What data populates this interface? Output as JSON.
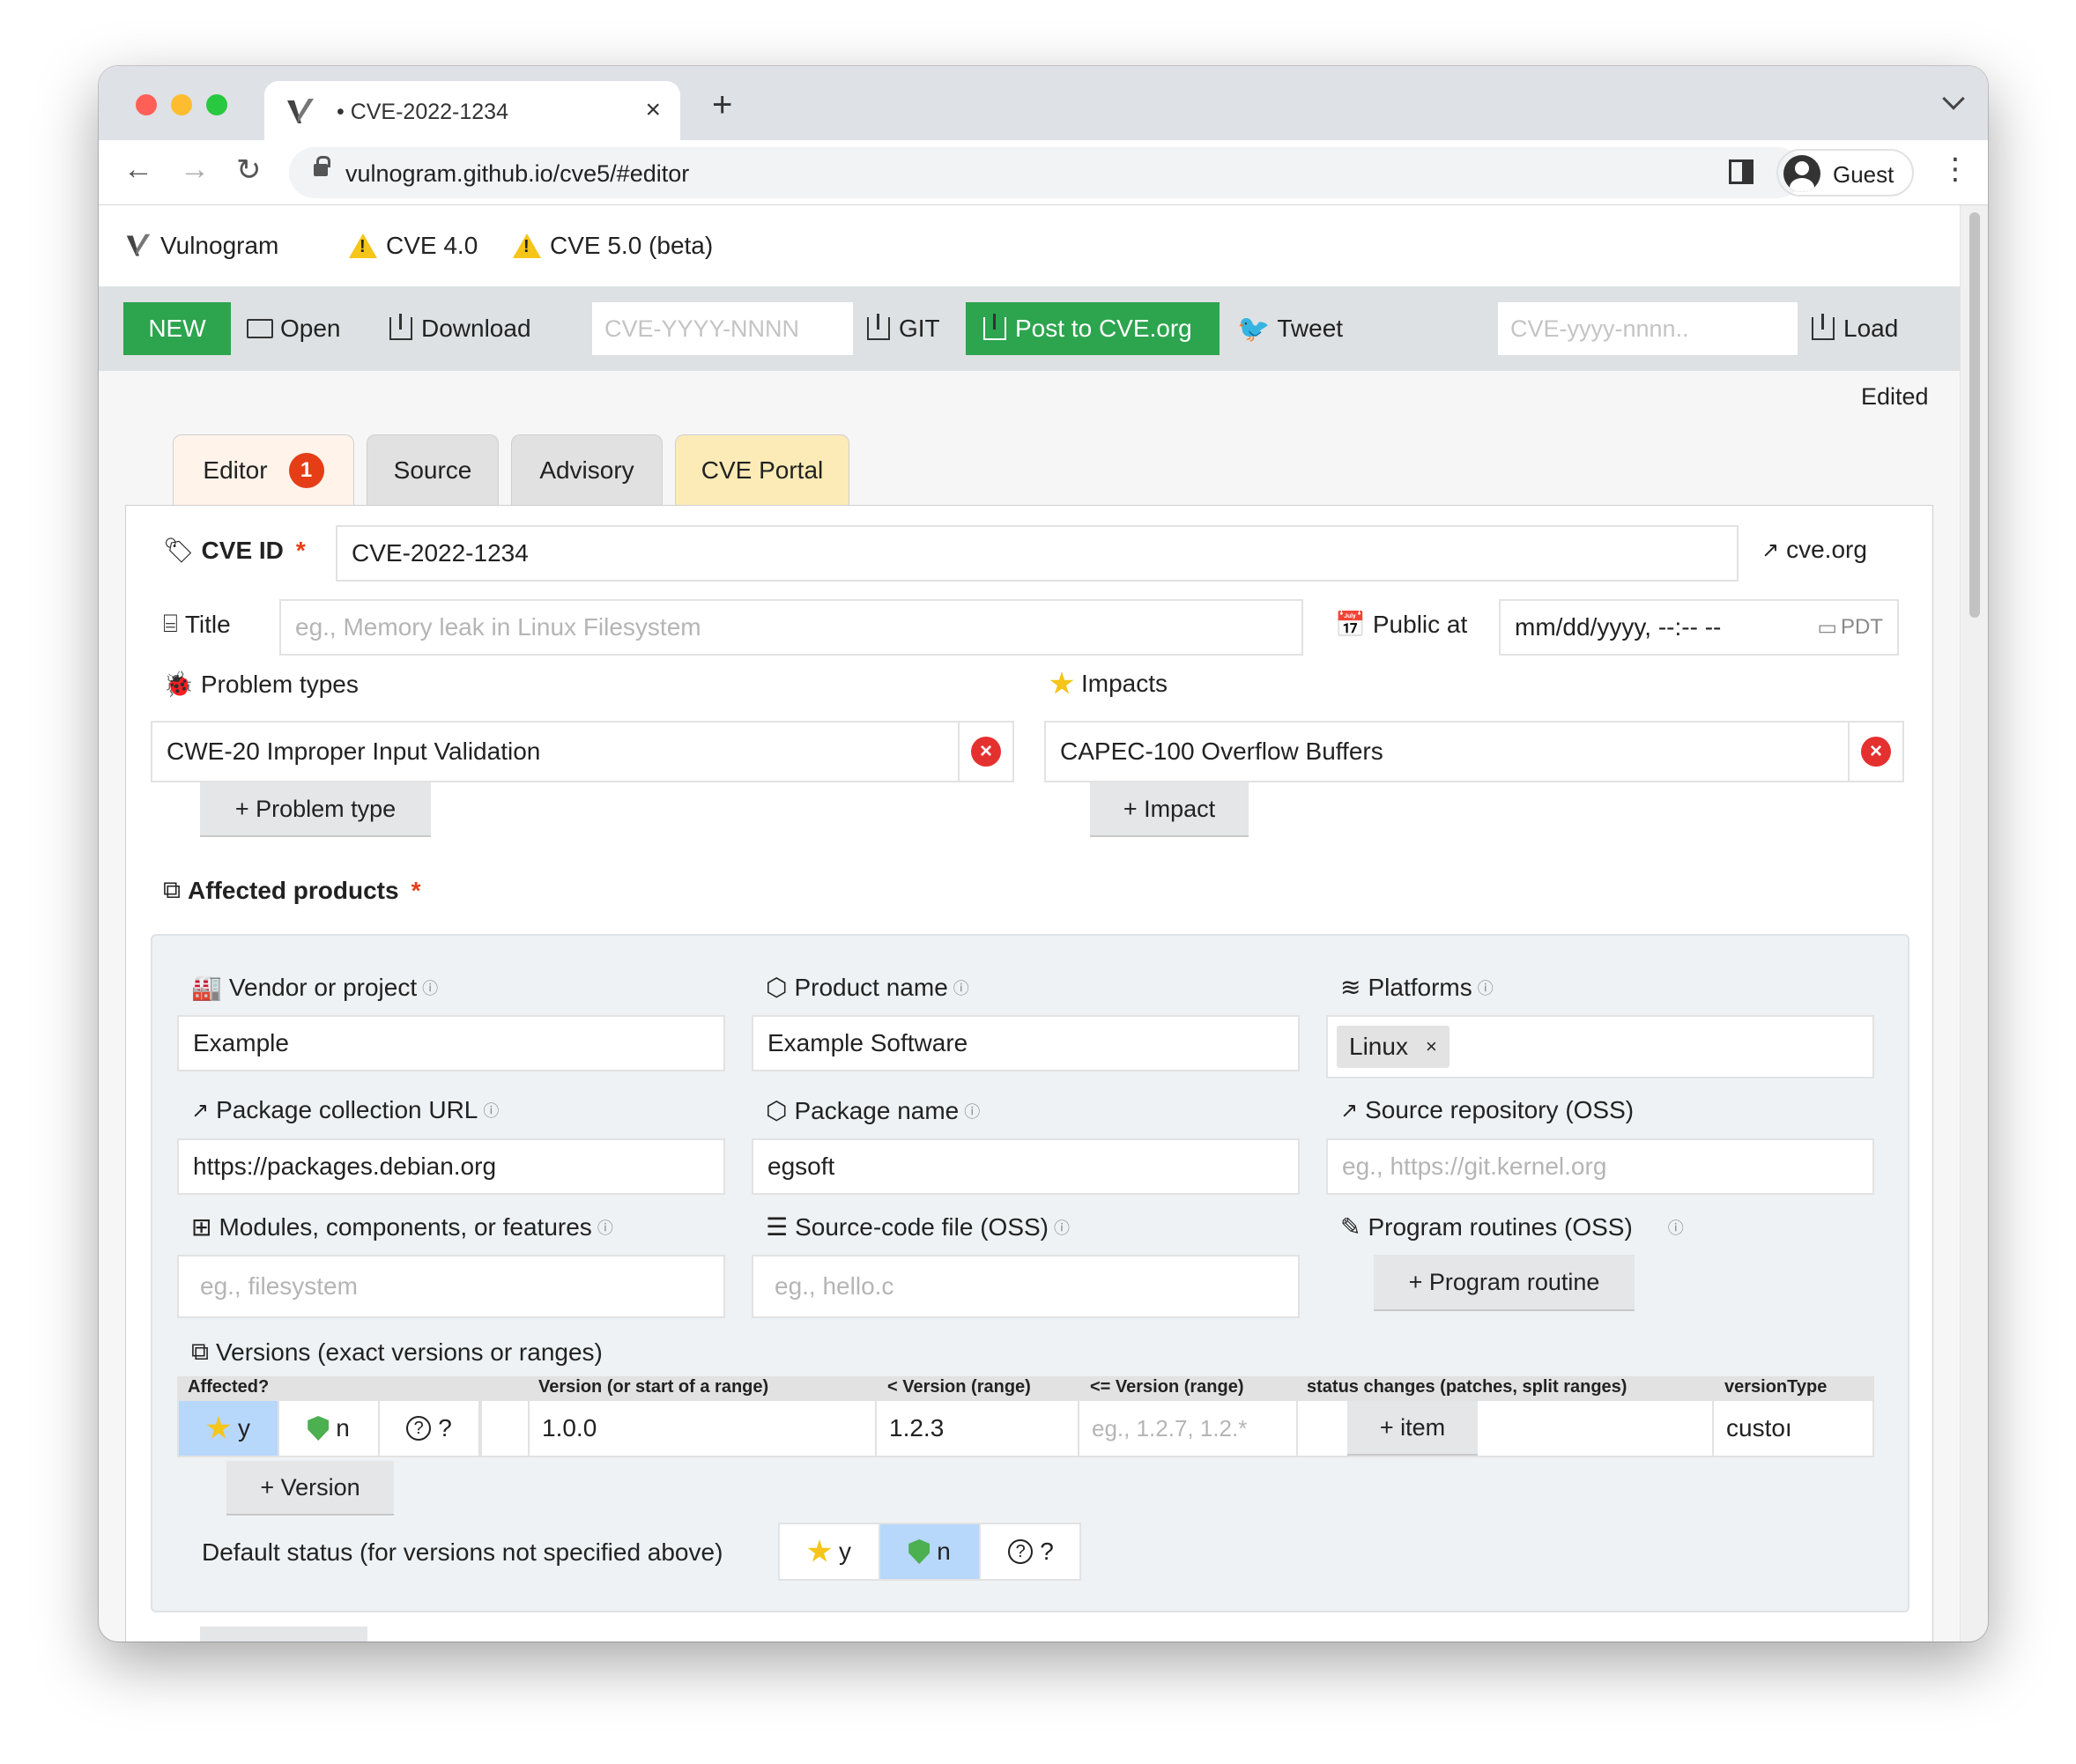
{
  "browser": {
    "tab_title": "• CVE-2022-1234",
    "tab_close": "×",
    "new_tab": "+",
    "url": "vulnogram.github.io/cve5/#editor",
    "profile": "Guest"
  },
  "app": {
    "brand": "Vulnogram",
    "nav_cve4": "CVE 4.0",
    "nav_cve5": "CVE 5.0 (beta)"
  },
  "actions": {
    "new": "NEW",
    "open": "Open",
    "download": "Download",
    "cve_placeholder": "CVE-YYYY-NNNN",
    "git": "GIT",
    "post": "Post to CVE.org",
    "tweet": "Tweet",
    "load_placeholder": "CVE-yyyy-nnnn..",
    "load": "Load"
  },
  "status": "Edited",
  "tabs": {
    "editor": "Editor",
    "editor_badge": "1",
    "source": "Source",
    "advisory": "Advisory",
    "portal": "CVE Portal"
  },
  "form": {
    "cve_id_label": "CVE ID",
    "required_mark": "*",
    "cve_id_value": "CVE-2022-1234",
    "cve_org_link": "cve.org",
    "title_label": "Title",
    "title_placeholder": "eg., Memory leak in Linux Filesystem",
    "public_at_label": "Public at",
    "public_at_value": "mm/dd/yyyy, --:-- --",
    "timezone": "PDT",
    "problem_types_label": "Problem types",
    "problem_type_value": "CWE-20 Improper Input Validation",
    "add_problem_type": "+ Problem type",
    "impacts_label": "Impacts",
    "impact_value": "CAPEC-100 Overflow Buffers",
    "add_impact": "+ Impact",
    "remove_mark": "×",
    "affected_label": "Affected products"
  },
  "product": {
    "vendor_label": "Vendor or project",
    "vendor_value": "Example",
    "product_label": "Product name",
    "product_value": "Example Software",
    "platforms_label": "Platforms",
    "platform_chip": "Linux",
    "chip_remove": "×",
    "pkg_url_label": "Package collection URL",
    "pkg_url_value": "https://packages.debian.org",
    "pkg_name_label": "Package name",
    "pkg_name_value": "egsoft",
    "repo_label": "Source repository (OSS)",
    "repo_placeholder": "eg., https://git.kernel.org",
    "modules_label": "Modules, components, or features",
    "modules_placeholder": "eg., filesystem",
    "srcfile_label": "Source-code file (OSS)",
    "srcfile_placeholder": "eg., hello.c",
    "routines_label": "Program routines (OSS)",
    "add_routine": "+ Program routine",
    "info_mark": "ⓘ"
  },
  "versions": {
    "label": "Versions (exact versions or ranges)",
    "headers": [
      "Affected?",
      "Version (or start of a range)",
      "< Version (range)",
      "<= Version (range)",
      "status changes (patches, split ranges)",
      "versionType"
    ],
    "affected_options": [
      "y",
      "n",
      "?"
    ],
    "row_version": "1.0.0",
    "row_less_than": "1.2.3",
    "row_lte_placeholder": "eg., 1.2.7, 1.2.*",
    "add_item": "+ item",
    "row_type": "custoı",
    "add_version": "+ Version",
    "default_status_label": "Default status (for versions not specified above)",
    "default_options": [
      "y",
      "n",
      "?"
    ]
  },
  "colors": {
    "green": "#2da44e",
    "badge": "#e53d16",
    "selected": "#b7d7fb"
  }
}
